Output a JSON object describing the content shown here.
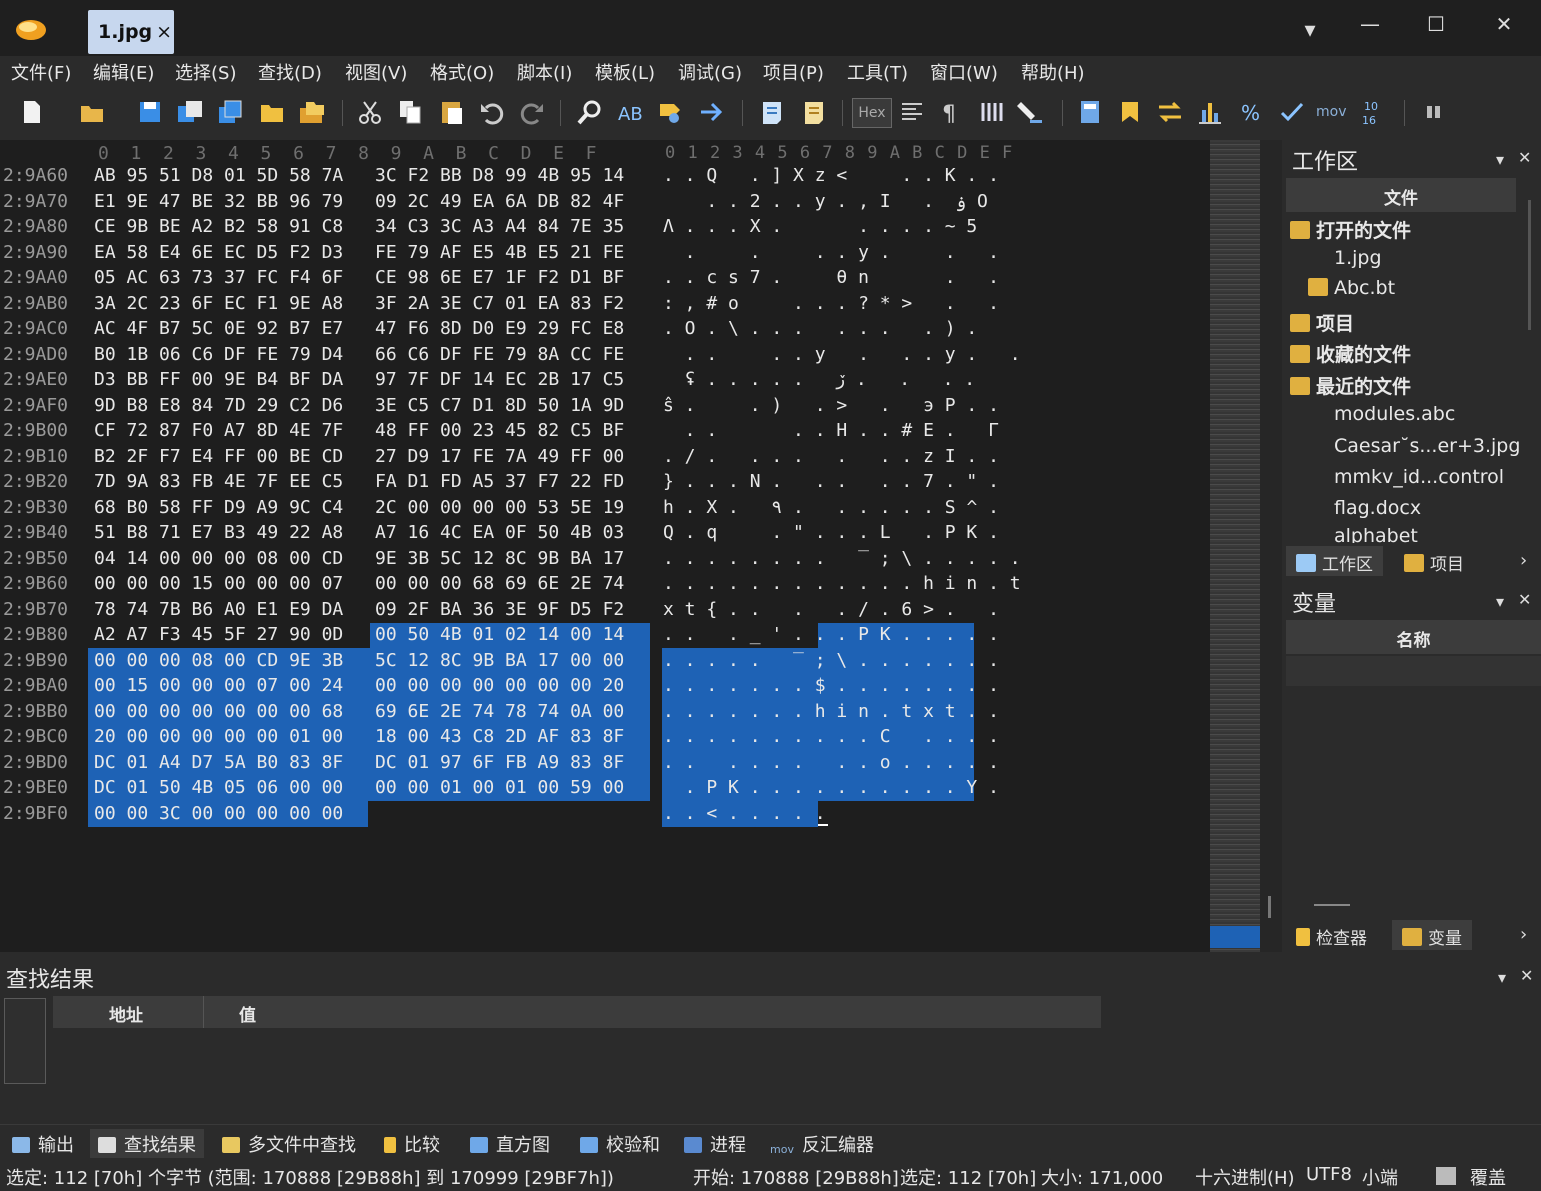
{
  "window": {
    "tab_label": "1.jpg",
    "tab_close": "×",
    "minimize": "—",
    "maximize": "☐",
    "close": "✕",
    "dropdown": "▾"
  },
  "menu": [
    "文件(F)",
    "编辑(E)",
    "选择(S)",
    "查找(D)",
    "视图(V)",
    "格式(O)",
    "脚本(I)",
    "模板(L)",
    "调试(G)",
    "项目(P)",
    "工具(T)",
    "窗口(W)",
    "帮助(H)"
  ],
  "toolbar": {
    "hex_label": "Hex",
    "mov_label": "mov",
    "icons": [
      "new-file-icon",
      "open-file-icon",
      "save-icon",
      "save-as-icon",
      "save-all-icon",
      "open-folder-icon",
      "open-project-icon",
      "cut-icon",
      "copy-icon",
      "paste-icon",
      "undo-icon",
      "redo-icon",
      "find-icon",
      "replace-icon",
      "goto-icon",
      "jump-icon",
      "run-script-icon",
      "run-template-icon",
      "hex-mode-icon",
      "align-icon",
      "pilcrow-icon",
      "columns-icon",
      "highlight-icon",
      "calculator-icon",
      "bookmark-icon",
      "compare-icon",
      "histogram-icon",
      "percent-icon",
      "checksum-icon",
      "disassembler-icon",
      "base-convert-icon",
      "pause-icon"
    ]
  },
  "hex": {
    "header_bytes": "0  1  2  3  4  5  6  7  8  9  A  B  C  D  E  F",
    "header_ascii": "0 1 2 3 4 5 6 7 8 9 A B C D E F",
    "rows": [
      {
        "addr": "2:9A60",
        "b1": "AB 95 51 D8 01 5D 58 7A",
        "b2": "3C F2 BB D8 99 4B 95 14",
        "ascii": ". . Q   . ] X z <     . . K . ."
      },
      {
        "addr": "2:9A70",
        "b1": "E1 9E 47 BE 32 BB 96 79",
        "b2": "09 2C 49 EA 6A DB 82 4F",
        "ascii": "    . . 2 . . y . , I   .  ۏ O"
      },
      {
        "addr": "2:9A80",
        "b1": "CE 9B BE A2 B2 58 91 C8",
        "b2": "34 C3 3C A3 A4 84 7E 35",
        "ascii": "Λ . . . X .       . . . . ~ 5"
      },
      {
        "addr": "2:9A90",
        "b1": "EA 58 E4 6E EC D5 F2 D3",
        "b2": "FE 79 AF E5 4B E5 21 FE",
        "ascii": "  .     .     . . y .     .   ."
      },
      {
        "addr": "2:9AA0",
        "b1": "05 AC 63 73 37 FC F4 6F",
        "b2": "CE 98 6E E7 1F F2 D1 BF",
        "ascii": ". . c s 7 .     θ n       .   ."
      },
      {
        "addr": "2:9AB0",
        "b1": "3A 2C 23 6F EC F1 9E A8",
        "b2": "3F 2A 3E C7 01 EA 83 F2",
        "ascii": ": , # o     . . . ? * >   .   ."
      },
      {
        "addr": "2:9AC0",
        "b1": "AC 4F B7 5C 0E 92 B7 E7",
        "b2": "47 F6 8D D0 E9 29 FC E8",
        "ascii": ". O . \\ . . .   . . .   . ) ."
      },
      {
        "addr": "2:9AD0",
        "b1": "B0 1B 06 C6 DF FE 79 D4",
        "b2": "66 C6 DF FE 79 8A CC FE",
        "ascii": "  . .     . . y   .   . . y .   ."
      },
      {
        "addr": "2:9AE0",
        "b1": "D3 BB FF 00 9E B4 BF DA",
        "b2": "97 7F DF 14 EC 2B 17 C5",
        "ascii": "  ʢ . . . . .   ڒ .   .   . ."
      },
      {
        "addr": "2:9AF0",
        "b1": "9D B8 E8 84 7D 29 C2 D6",
        "b2": "3E C5 C7 D1 8D 50 1A 9D",
        "ascii": "ŝ .     . )   . >   .   э P . ."
      },
      {
        "addr": "2:9B00",
        "b1": "CF 72 87 F0 A7 8D 4E 7F",
        "b2": "48 FF 00 23 45 82 C5 BF",
        "ascii": "  . .       . . H . . # E .   Γ"
      },
      {
        "addr": "2:9B10",
        "b1": "B2 2F F7 E4 FF 00 BE CD",
        "b2": "27 D9 17 FE 7A 49 FF 00",
        "ascii": ". / .   . . .   .   . . z I . ."
      },
      {
        "addr": "2:9B20",
        "b1": "7D 9A 83 FB 4E 7F EE C5",
        "b2": "FA D1 FD A5 37 F7 22 FD",
        "ascii": "} . . . N .   . .   . . 7 . \" ."
      },
      {
        "addr": "2:9B30",
        "b1": "68 B0 58 FF D9 A9 9C C4",
        "b2": "2C 00 00 00 00 53 5E 19",
        "ascii": "h . X .   ٩ .   . . . . . S ^ ."
      },
      {
        "addr": "2:9B40",
        "b1": "51 B8 71 E7 B3 49 22 A8",
        "b2": "A7 16 4C EA 0F 50 4B 03",
        "ascii": "Q . q     . \" . . . L   . P K ."
      },
      {
        "addr": "2:9B50",
        "b1": "04 14 00 00 00 08 00 CD",
        "b2": "9E 3B 5C 12 8C 9B BA 17",
        "ascii": ". . . . . . . .   ‾ ; \\ . . . . ."
      },
      {
        "addr": "2:9B60",
        "b1": "00 00 00 15 00 00 00 07",
        "b2": "00 00 00 68 69 6E 2E 74",
        "ascii": ". . . . . . . . . . . . h i n . t"
      },
      {
        "addr": "2:9B70",
        "b1": "78 74 7B B6 A0 E1 E9 DA",
        "b2": "09 2F BA 36 3E 9F D5 F2",
        "ascii": "x t { . .   .   . / . 6 > .   ."
      },
      {
        "addr": "2:9B80",
        "b1": "A2 A7 F3 45 5F 27 90 0D",
        "b2": "00 50 4B 01 02 14 00 14",
        "ascii": ". .   . _ ' . . . P K . . . . ."
      },
      {
        "addr": "2:9B90",
        "b1": "00 00 00 08 00 CD 9E 3B",
        "b2": "5C 12 8C 9B BA 17 00 00",
        "ascii": ". . . . .   ‾ ; \\ . . . . . . ."
      },
      {
        "addr": "2:9BA0",
        "b1": "00 15 00 00 00 07 00 24",
        "b2": "00 00 00 00 00 00 00 20",
        "ascii": ". . . . . . . $ . . . . . . . ."
      },
      {
        "addr": "2:9BB0",
        "b1": "00 00 00 00 00 00 00 68",
        "b2": "69 6E 2E 74 78 74 0A 00",
        "ascii": ". . . . . . . h i n . t x t . ."
      },
      {
        "addr": "2:9BC0",
        "b1": "20 00 00 00 00 00 01 00",
        "b2": "18 00 43 C8 2D AF 83 8F",
        "ascii": ". . . . . . . . . . C   . . . ."
      },
      {
        "addr": "2:9BD0",
        "b1": "DC 01 A4 D7 5A B0 83 8F",
        "b2": "DC 01 97 6F FB A9 83 8F",
        "ascii": ". .   . . . .   . . o . . . . ."
      },
      {
        "addr": "2:9BE0",
        "b1": "DC 01 50 4B 05 06 00 00",
        "b2": "00 00 01 00 01 00 59 00",
        "ascii": "  . P K . . . . . . . . . . Y ."
      },
      {
        "addr": "2:9BF0",
        "b1": "00 00 3C 00 00 00 00 00",
        "b2": "",
        "ascii": ". . < . . . . ."
      }
    ]
  },
  "workspace": {
    "title": "工作区",
    "col_header": "文件",
    "items": [
      {
        "label": "打开的文件",
        "bold": true
      },
      {
        "label": "1.jpg",
        "bold": false
      },
      {
        "label": "Abc.bt",
        "bold": false
      },
      {
        "label": "项目",
        "bold": true
      },
      {
        "label": "收藏的文件",
        "bold": true
      },
      {
        "label": "最近的文件",
        "bold": true
      },
      {
        "label": "modules.abc",
        "bold": false
      },
      {
        "label": "Caesar˘s...er+3.jpg",
        "bold": false
      },
      {
        "label": "mmkv_id...control",
        "bold": false
      },
      {
        "label": "flag.docx",
        "bold": false
      },
      {
        "label": "alphabet",
        "bold": false
      }
    ],
    "tabs": [
      "工作区",
      "项目"
    ]
  },
  "variables": {
    "title": "变量",
    "col_header": "名称",
    "tabs": [
      "检查器",
      "变量"
    ]
  },
  "find_results": {
    "title": "查找结果",
    "col_address": "地址",
    "col_value": "值"
  },
  "bottom_tabs": [
    "输出",
    "查找结果",
    "多文件中查找",
    "比较",
    "直方图",
    "校验和",
    "进程",
    "反汇编器"
  ],
  "status": {
    "selection": "选定: 112 [70h] 个字节 (范围: 170888 [29B88h] 到 170999 [29BF7h])",
    "start": "开始: 170888 [29B88h]",
    "selected": "选定: 112 [70h]",
    "size": "大小: 171,000",
    "mode": "十六进制(H)",
    "encoding": "UTF8",
    "endian": "小端",
    "insert_mode": "覆盖"
  }
}
